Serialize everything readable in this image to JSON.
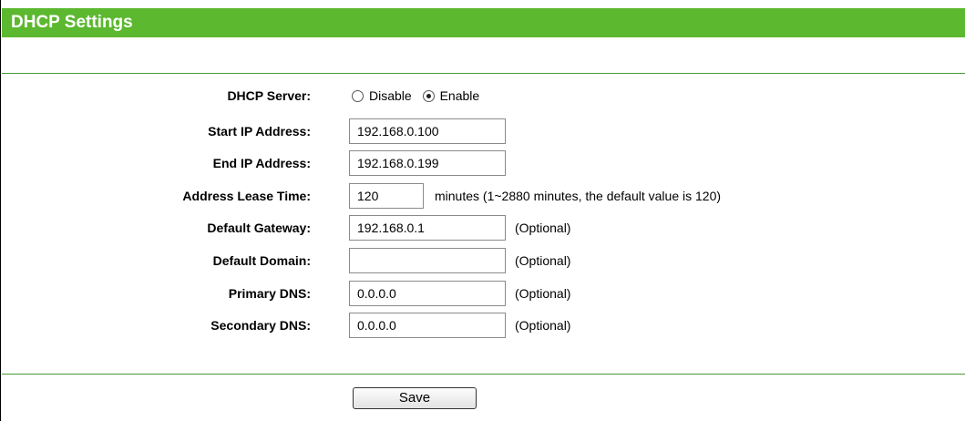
{
  "header": {
    "title": "DHCP Settings"
  },
  "form": {
    "dhcp_server": {
      "label": "DHCP Server:",
      "options": [
        {
          "label": "Disable",
          "checked": false
        },
        {
          "label": "Enable",
          "checked": true
        }
      ]
    },
    "start_ip": {
      "label": "Start IP Address:",
      "value": "192.168.0.100"
    },
    "end_ip": {
      "label": "End IP Address:",
      "value": "192.168.0.199"
    },
    "lease_time": {
      "label": "Address Lease Time:",
      "value": "120",
      "hint": "minutes (1~2880 minutes, the default value is 120)"
    },
    "default_gateway": {
      "label": "Default Gateway:",
      "value": "192.168.0.1",
      "hint": "(Optional)"
    },
    "default_domain": {
      "label": "Default Domain:",
      "value": "",
      "hint": "(Optional)"
    },
    "primary_dns": {
      "label": "Primary DNS:",
      "value": "0.0.0.0",
      "hint": "(Optional)"
    },
    "secondary_dns": {
      "label": "Secondary DNS:",
      "value": "0.0.0.0",
      "hint": "(Optional)"
    }
  },
  "footer": {
    "save_label": "Save"
  },
  "colors": {
    "title_bar": "#5cb82f",
    "divider": "#4a9a3a"
  }
}
